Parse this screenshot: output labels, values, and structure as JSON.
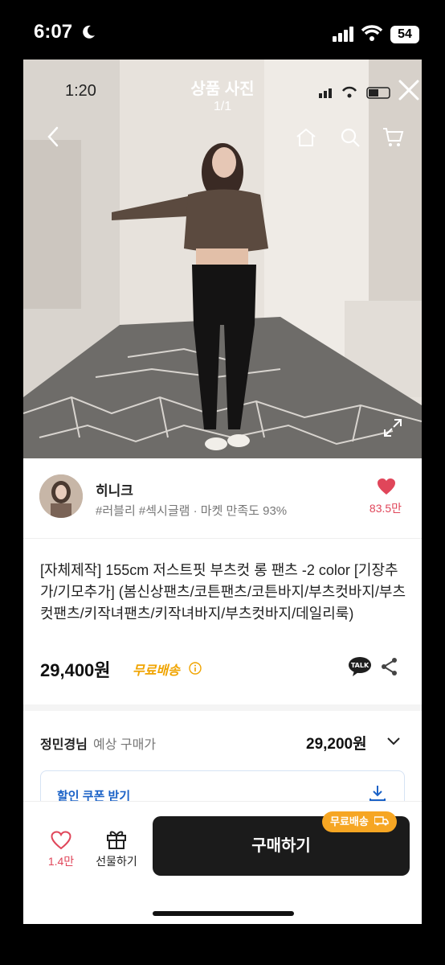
{
  "outer_status": {
    "time": "6:07",
    "battery": "54"
  },
  "inner_status": {
    "time": "1:20"
  },
  "photo_viewer": {
    "title": "상품 사진",
    "counter": "1/1"
  },
  "seller": {
    "name": "히니크",
    "tags": "#러블리 #섹시글램 · 마켓 만족도 93%",
    "likes": "83.5만"
  },
  "product": {
    "title": "[자체제작] 155cm 저스트핏 부츠컷 롱 팬츠 -2 color [기장추가/기모추가] (봄신상팬츠/코튼팬츠/코튼바지/부츠컷바지/부츠컷팬츠/키작녀팬츠/키작녀바지/부츠컷바지/데일리룩)",
    "price": "29,400원",
    "shipping": "무료배송"
  },
  "member": {
    "name": "정민경님",
    "label": "예상 구매가",
    "price": "29,200원"
  },
  "coupon": {
    "label": "할인 쿠폰 받기"
  },
  "bottom_bar": {
    "wish_count": "1.4만",
    "gift_label": "선물하기",
    "buy_label": "구매하기",
    "free_badge": "무료배송"
  },
  "colors": {
    "accent_red": "#e0465a",
    "shipping_orange": "#f0a400",
    "buy_dark": "#1b1b1b",
    "coupon_blue": "#1b62c7"
  }
}
